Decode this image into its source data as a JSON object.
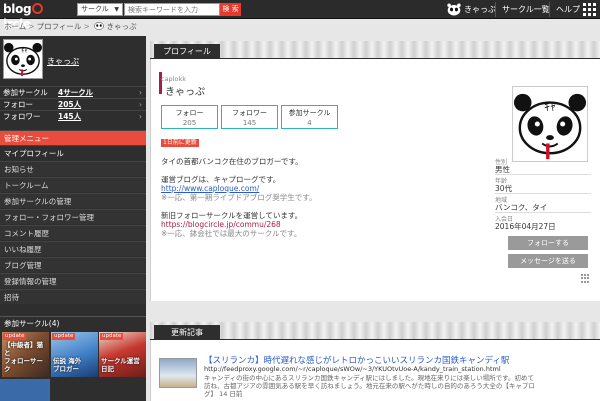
{
  "topbar": {
    "logo": "blogCircle",
    "search_select": "サークル",
    "search_placeholder": "検索キーワードを入力",
    "search_button": "検 索",
    "user_name": "きゃっぷ",
    "circle_menu": "サークル一覧",
    "help": "ヘルプ"
  },
  "breadcrumb": {
    "home": "ホーム",
    "profile": "プロフィール",
    "name": "きゃっぷ"
  },
  "sidebar": {
    "name": "きゃっぷ",
    "stats": [
      {
        "label": "参加サークル",
        "value": "4サークル"
      },
      {
        "label": "フォロー",
        "value": "205人"
      },
      {
        "label": "フォロワー",
        "value": "145人"
      }
    ],
    "menu_header": "管理メニュー",
    "menu": [
      "マイプロフィール",
      "お知らせ",
      "トークルーム",
      "参加サークルの管理",
      "フォロー・フォロワー管理",
      "コメント履歴",
      "いいね履歴",
      "ブログ管理",
      "登録情報の管理",
      "招待"
    ],
    "circles_title": "参加サークル(4)",
    "circles": [
      {
        "badge": "update",
        "caption": "【中級者】猫と\nフォローサーク"
      },
      {
        "badge": "update",
        "caption": "伝説 海外\nブロガー"
      },
      {
        "badge": "update",
        "caption": "サークル運営\n日記"
      }
    ]
  },
  "profile": {
    "tab": "プロフィール",
    "user_id": "caplokk",
    "name": "きゃっぷ",
    "stats": [
      {
        "label": "フォロー",
        "value": "205"
      },
      {
        "label": "フォロワー",
        "value": "145"
      },
      {
        "label": "参加サークル",
        "value": "4"
      }
    ],
    "update_tag": "1日前に更新",
    "desc": [
      "タイの首都バンコク在住のブロガーです。",
      "",
      "運営ブログは、キャプローグです。",
      "http://www.caploque.com/",
      "※一応、第一期ライブドアブログ奨学生です。",
      "",
      "新旧フォローサークルを運営しています。",
      "https://blogcircle.jp/commu/268",
      "※一応、鉢会社では最大のサークルです。"
    ],
    "info": [
      {
        "key": "性別",
        "value": "男性"
      },
      {
        "key": "年齢",
        "value": "30代"
      },
      {
        "key": "地域",
        "value": "バンコク、タイ"
      },
      {
        "key": "入会日",
        "value": "2016年04月27日"
      }
    ],
    "follow_button": "フォローする",
    "message_button": "メッセージを送る"
  },
  "articles": {
    "tab": "更新記事",
    "items": [
      {
        "title": "【スリランカ】時代遅れな感じがレトロかっこいいスリランカ国鉄キャンディ駅",
        "url": "http://feedproxy.google.com/~r/caploque/sWOw/~3/YKUOtvUoe-A/kandy_train_station.html",
        "body": [
          "キャンディの街の中心にあるスリランカ国鉄キャンディ駅にはしました。現地在来りには楽しい場所です。初めて",
          "訪ね、古都アジアの雰囲気ある駅を早く訪ねましょう。地元在来の駅へがた時しの自的のあろう大全の【キャプロ",
          "グ】 14 日前"
        ]
      }
    ]
  }
}
